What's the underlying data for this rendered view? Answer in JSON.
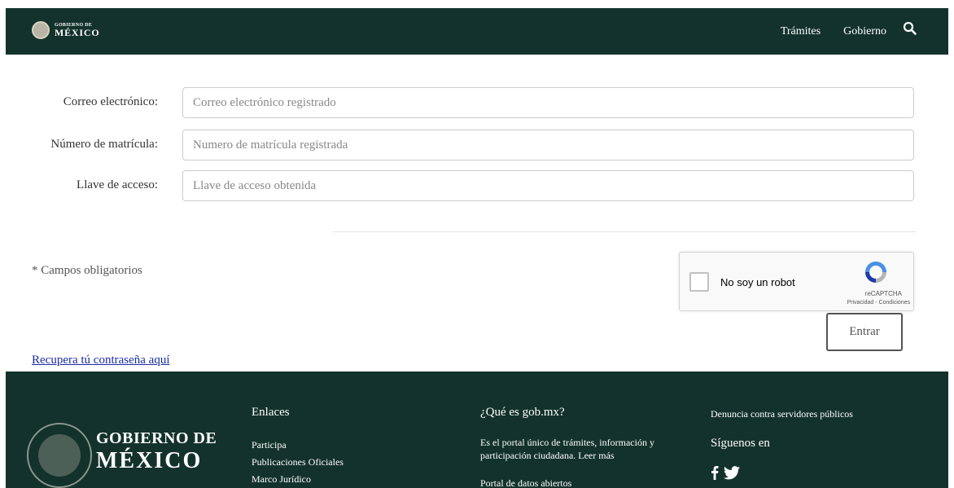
{
  "header": {
    "logo_small": "GOBIERNO DE",
    "logo_big": "MÉXICO",
    "nav": [
      {
        "label": "Trámites"
      },
      {
        "label": "Gobierno"
      }
    ],
    "search_icon": "search-icon"
  },
  "form": {
    "email": {
      "label": "Correo electrónico:",
      "placeholder": "Correo electrónico registrado",
      "value": ""
    },
    "matricula": {
      "label": "Número de matrícula:",
      "placeholder": "Numero de matrícula registrada",
      "value": ""
    },
    "key": {
      "label": "Llave de acceso:",
      "placeholder": "Llave de acceso obtenida",
      "value": ""
    },
    "required_note": "* Campos obligatorios",
    "submit_label": "Entrar",
    "recover_link": "Recupera tú contraseña aquí"
  },
  "recaptcha": {
    "label": "No soy un robot",
    "brand": "reCAPTCHA",
    "terms": "Privacidad - Condiciones",
    "checked": false
  },
  "footer": {
    "logo_line1": "GOBIERNO DE",
    "logo_line2": "MÉXICO",
    "links_title": "Enlaces",
    "links": [
      "Participa",
      "Publicaciones Oficiales",
      "Marco Jurídico"
    ],
    "about_title": "¿Qué es gob.mx?",
    "about_text": "Es el portal único de trámites, información y participación ciudadana. Leer más",
    "open_data": "Portal de datos abiertos",
    "complaint": "Denuncia contra servidores públicos",
    "follow_title": "Síguenos en",
    "social_icons": [
      "facebook-icon",
      "twitter-icon"
    ]
  },
  "colors": {
    "brand_dark_green": "#13322b",
    "link_blue": "#1b2ba5"
  }
}
